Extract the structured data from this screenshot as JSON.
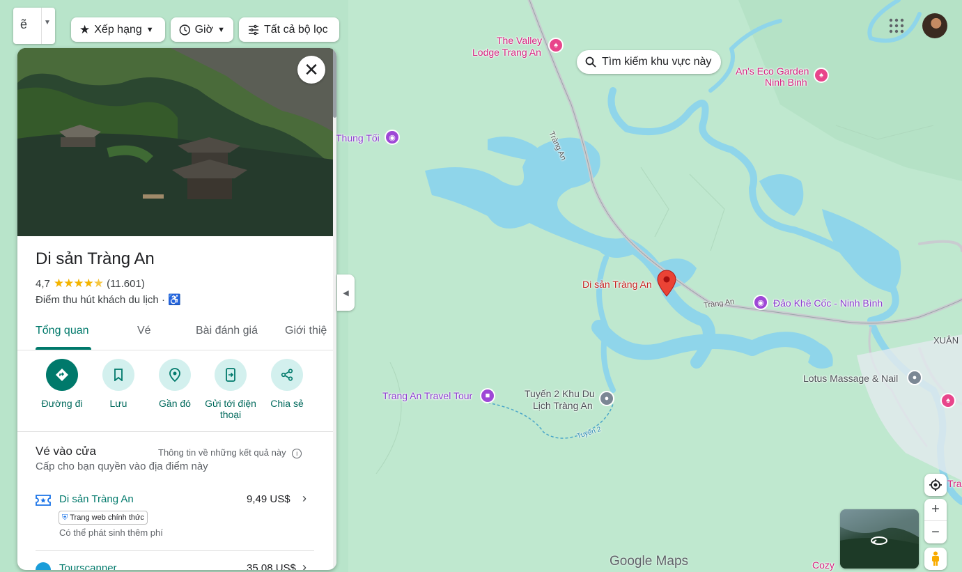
{
  "filters": {
    "rating_label": "Xếp hạng",
    "hours_label": "Giờ",
    "all_filters_label": "Tất cả bộ lọc",
    "search_area_label": "Tìm kiếm khu vực này"
  },
  "map": {
    "labels": {
      "valley_lodge_line1": "The Valley",
      "valley_lodge_line2": "Lodge Trang An",
      "ans_eco_line1": "An's Eco Garden",
      "ans_eco_line2": "Ninh Binh",
      "thung_toi": "Thung Tối",
      "trang_an_road_1": "Tràng An",
      "trang_an_road_2": "Tràng An",
      "selected_place": "Di sản Tràng An",
      "khe_coc": "Đảo Khê Cốc - Ninh Bình",
      "xuan": "XUÂN",
      "lotus": "Lotus Massage & Nail",
      "travel_tour": "Trang An Travel Tour",
      "tuyen2_line1": "Tuyến 2 Khu Du",
      "tuyen2_line2": "Lịch Tràng An",
      "tuyen2_path": "Tuyến 2",
      "cozy_partial": "Cozy",
      "tran_partial": "Tran"
    },
    "google_logo": "Google Maps",
    "colors": {
      "land": "#bfe8cf",
      "water": "#8fd5ea",
      "road": "#c9ccd0",
      "pin": "#ea4335"
    }
  },
  "panel": {
    "title": "Di sản Tràng An",
    "rating": "4,7",
    "stars": 4.7,
    "review_count": "(11.601)",
    "category": "Điểm thu hút khách du lịch",
    "tabs": [
      "Tổng quan",
      "Vé",
      "Bài đánh giá",
      "Giới thiệ"
    ],
    "actions": {
      "directions": "Đường đi",
      "save": "Lưu",
      "nearby": "Gần đó",
      "send_to_phone_line1": "Gửi tới điện",
      "send_to_phone_line2": "thoại",
      "share": "Chia sẻ"
    },
    "tickets": {
      "title": "Vé vào cửa",
      "info": "Thông tin về những kết quả này",
      "subtitle": "Cấp cho bạn quyền vào địa điểm này",
      "items": [
        {
          "name": "Di sản Tràng An",
          "price": "9,49 US$",
          "badge": "Trang web chính thức",
          "note": "Có thể phát sinh thêm phí"
        },
        {
          "name": "Tourscanner",
          "price": "35,08 US$"
        }
      ]
    }
  }
}
